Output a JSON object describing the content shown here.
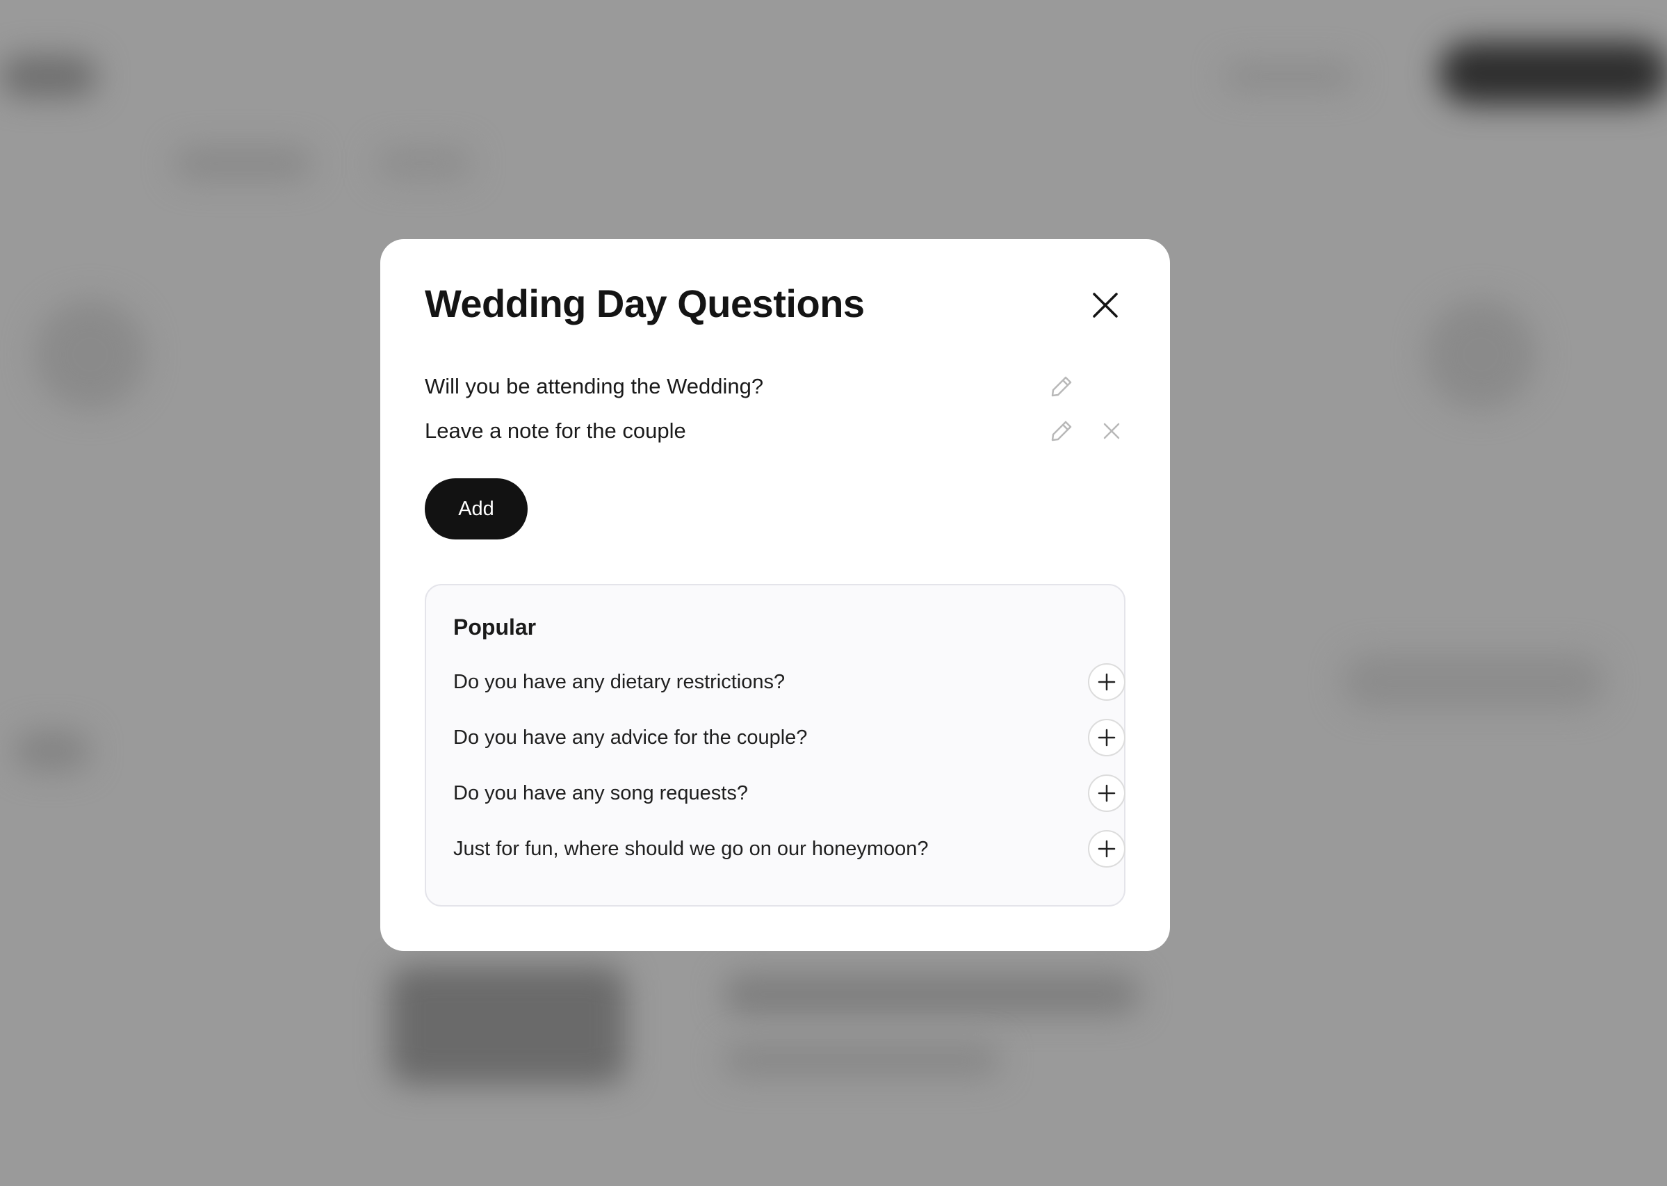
{
  "modal": {
    "title": "Wedding Day Questions",
    "close_icon": "close-icon",
    "questions": [
      {
        "text": "Will you be attending the Wedding?",
        "edit_icon": "pencil-icon",
        "removable": false
      },
      {
        "text": "Leave a note for the couple",
        "edit_icon": "pencil-icon",
        "removable": true,
        "remove_icon": "close-icon"
      }
    ],
    "add_label": "Add"
  },
  "popular": {
    "title": "Popular",
    "items": [
      {
        "text": "Do you have any dietary restrictions?",
        "icon": "plus-icon"
      },
      {
        "text": "Do you have any advice for the couple?",
        "icon": "plus-icon"
      },
      {
        "text": "Do you have any song requests?",
        "icon": "plus-icon"
      },
      {
        "text": "Just for fun, where should we go on our honeymoon?",
        "icon": "plus-icon"
      }
    ]
  },
  "colors": {
    "backdrop": "#9a9a9a",
    "modal_bg": "#ffffff",
    "primary_button": "#121212",
    "popular_bg": "#fafafc",
    "muted_icon": "#b8b8b8"
  }
}
